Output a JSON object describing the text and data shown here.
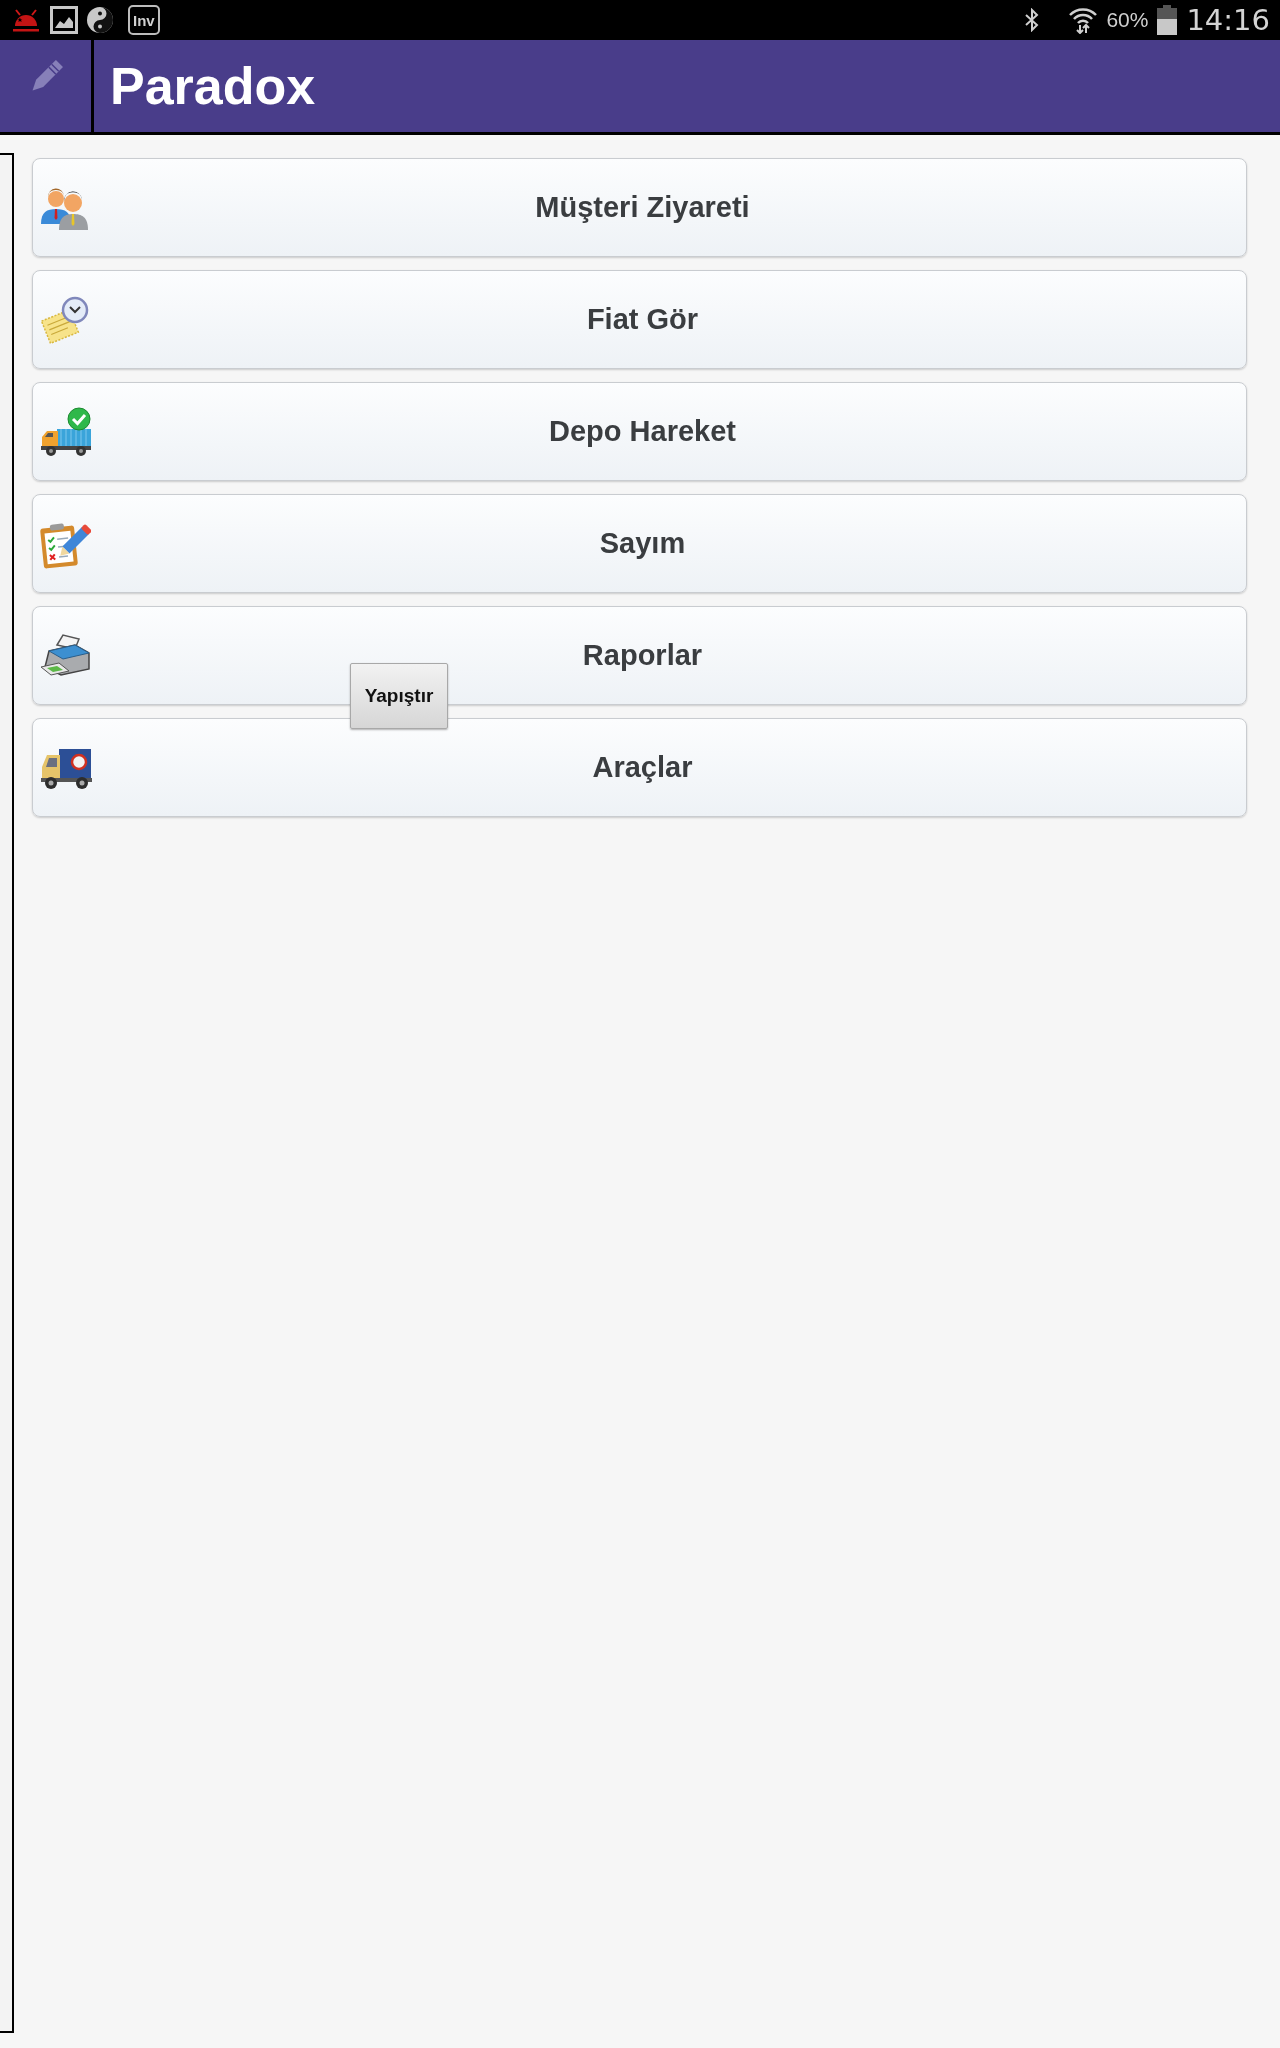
{
  "status_bar": {
    "notification_tile": "Inv",
    "battery": "60%",
    "time": "14:16"
  },
  "header": {
    "title": "Paradox"
  },
  "menu": [
    {
      "label": "Müşteri Ziyareti"
    },
    {
      "label": "Fiat Gör"
    },
    {
      "label": "Depo Hareket"
    },
    {
      "label": "Sayım"
    },
    {
      "label": "Raporlar"
    },
    {
      "label": "Araçlar"
    }
  ],
  "popup": {
    "label": "Yapıştır"
  }
}
